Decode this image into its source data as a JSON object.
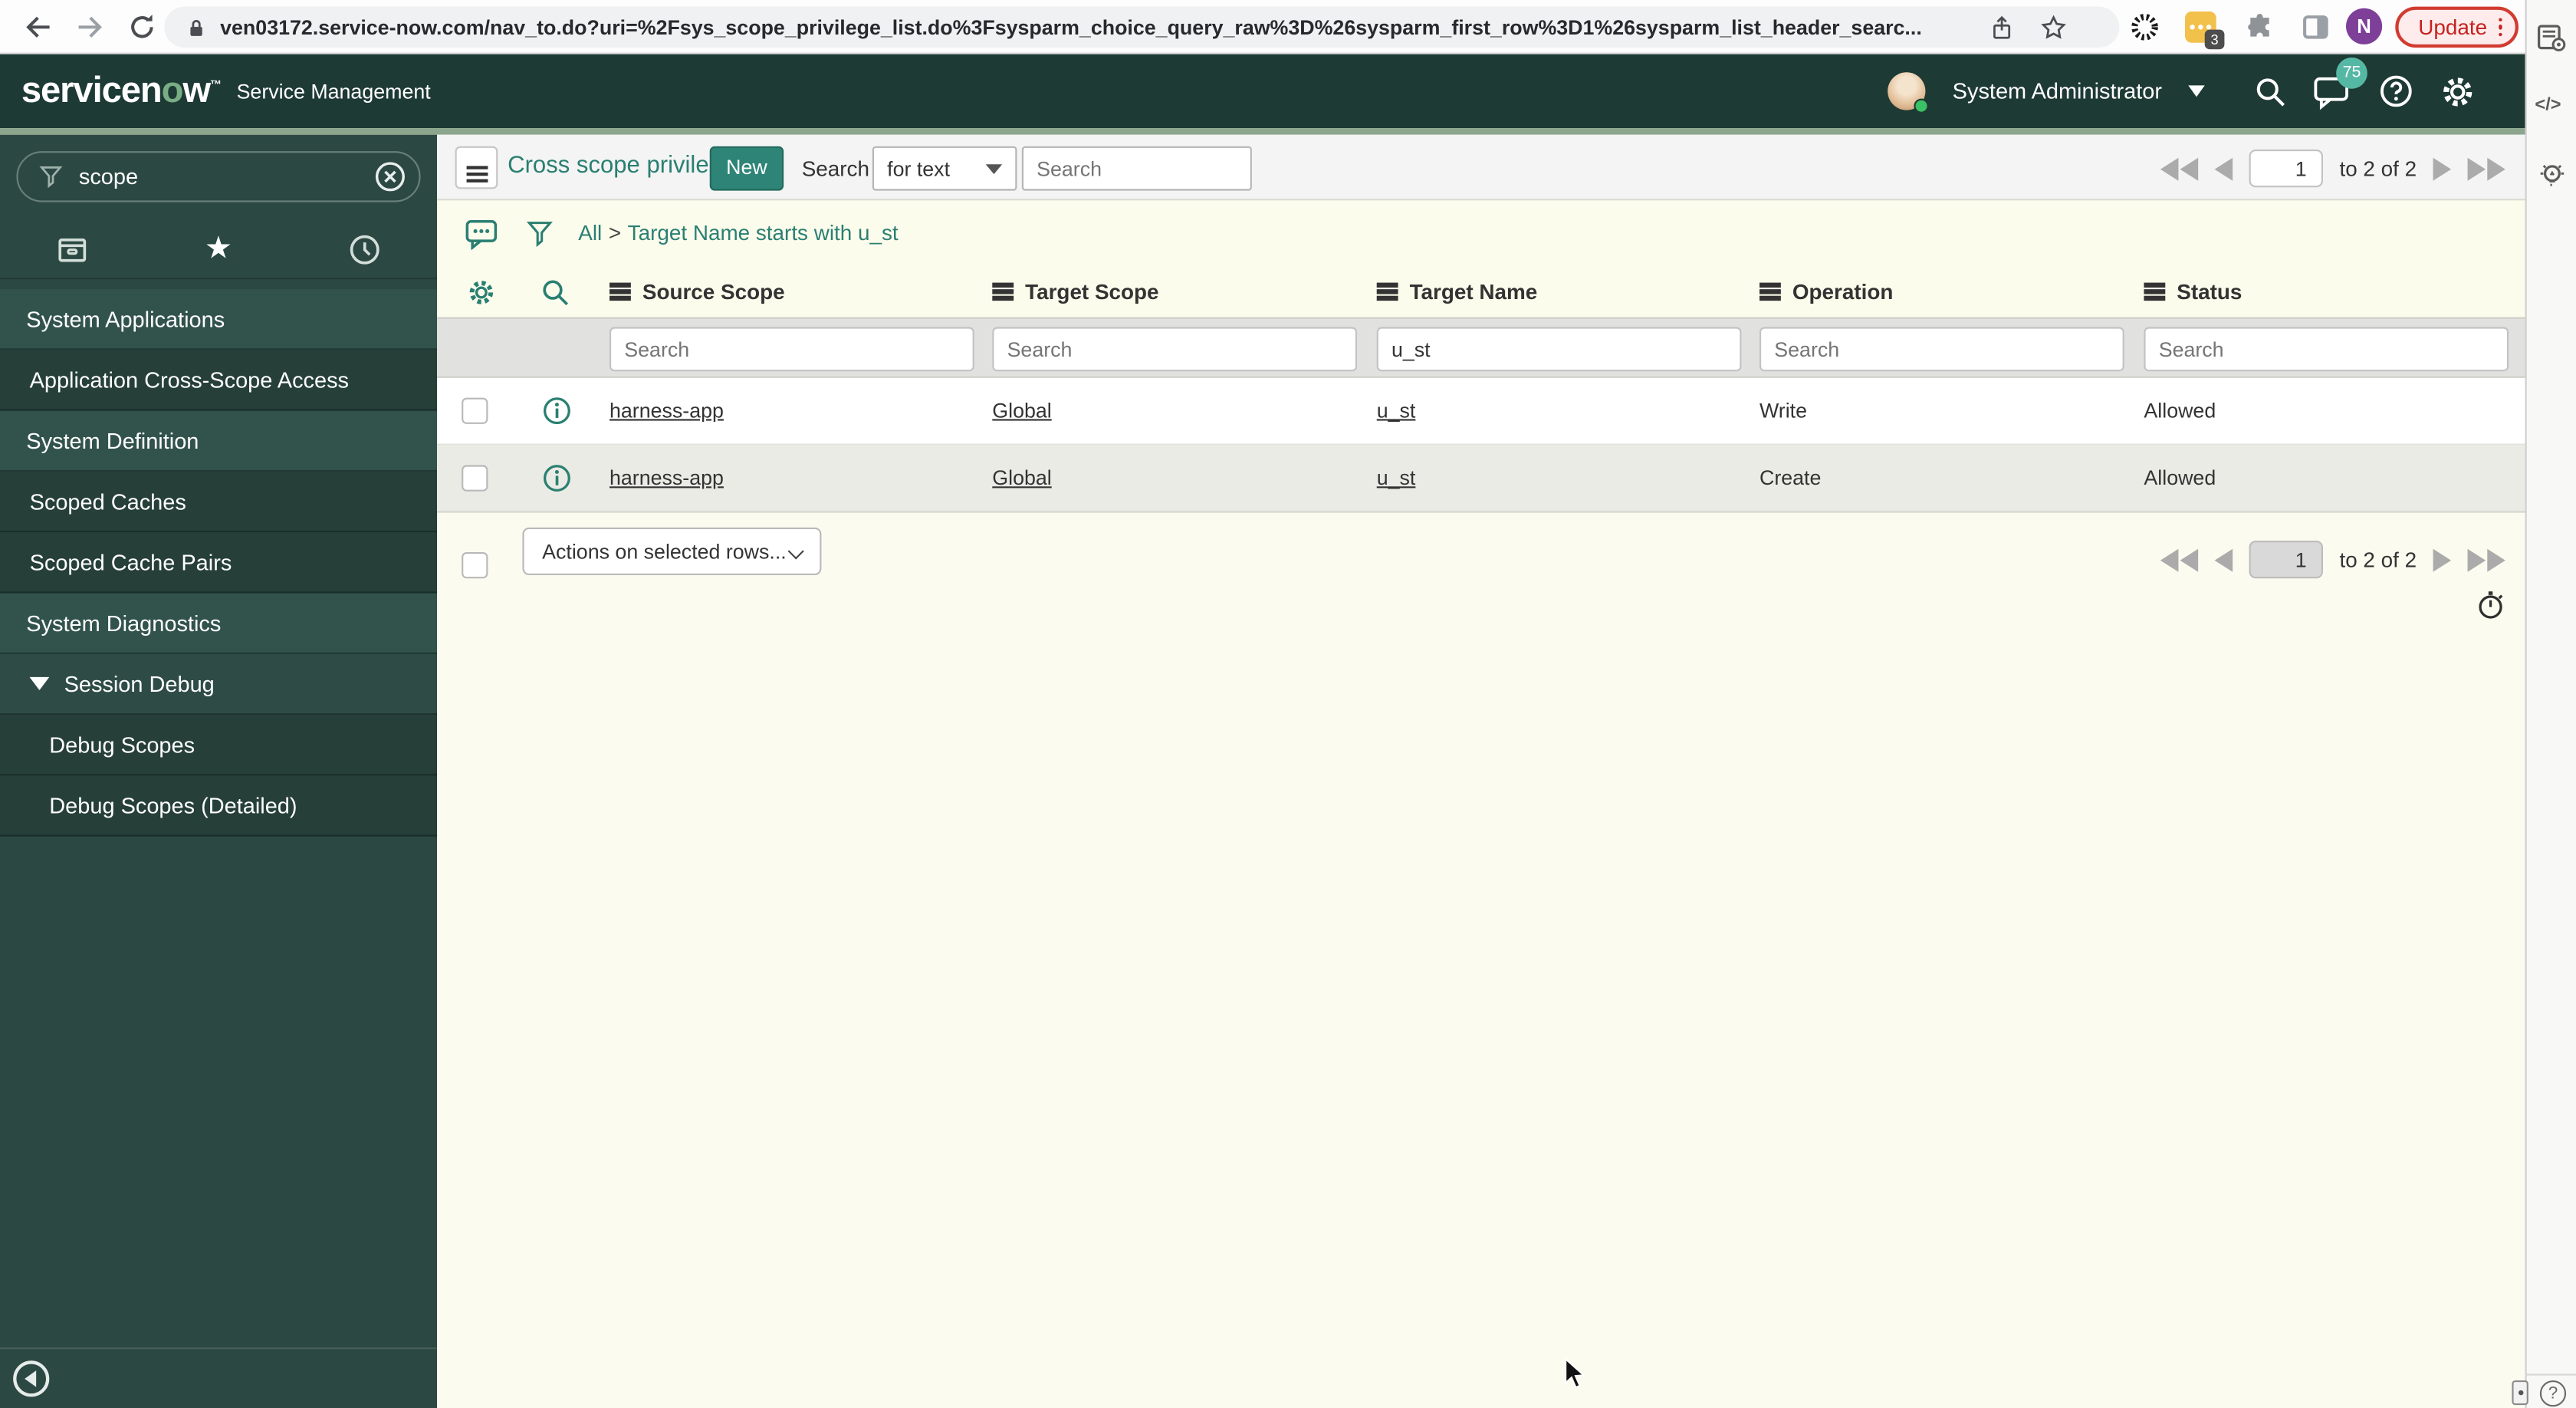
{
  "browser": {
    "url": "ven03172.service-now.com/nav_to.do?uri=%2Fsys_scope_privilege_list.do%3Fsysparm_choice_query_raw%3D%26sysparm_first_row%3D1%26sysparm_list_header_searc...",
    "extension_badge": "3",
    "profile_initial": "N",
    "update_label": "Update"
  },
  "app_header": {
    "logo_pre": "servicen",
    "logo_o": "o",
    "logo_post": "w",
    "product": "Service Management",
    "user_name": "System Administrator",
    "notification_count": "75"
  },
  "sidebar": {
    "filter_value": "scope",
    "items": [
      {
        "label": "System Applications",
        "type": "section"
      },
      {
        "label": "Application Cross-Scope Access",
        "type": "item"
      },
      {
        "label": "System Definition",
        "type": "section"
      },
      {
        "label": "Scoped Caches",
        "type": "item"
      },
      {
        "label": "Scoped Cache Pairs",
        "type": "item"
      },
      {
        "label": "System Diagnostics",
        "type": "section"
      },
      {
        "label": "Session Debug",
        "type": "subsection"
      },
      {
        "label": "Debug Scopes",
        "type": "subitem"
      },
      {
        "label": "Debug Scopes (Detailed)",
        "type": "subitem"
      }
    ]
  },
  "toolbar": {
    "title": "Cross scope privileges",
    "new_button": "New",
    "search_label": "Search",
    "search_type": "for text",
    "search_placeholder": "Search"
  },
  "pagination": {
    "page": "1",
    "range_label": "to 2 of 2"
  },
  "breadcrumb": {
    "root": "All",
    "separator": ">",
    "query": "Target Name starts with u_st"
  },
  "table": {
    "columns": [
      "Source Scope",
      "Target Scope",
      "Target Name",
      "Operation",
      "Status"
    ],
    "filter_placeholder": "Search",
    "target_name_filter": "u_st",
    "rows": [
      {
        "source_scope": "harness-app",
        "target_scope": "Global",
        "target_name": "u_st",
        "operation": "Write",
        "status": "Allowed"
      },
      {
        "source_scope": "harness-app",
        "target_scope": "Global",
        "target_name": "u_st",
        "operation": "Create",
        "status": "Allowed"
      }
    ]
  },
  "footer": {
    "actions_label": "Actions on selected rows..."
  },
  "right_strip": {
    "code_glyph": "</>",
    "help_glyph": "?"
  },
  "colors": {
    "teal": "#2e8577",
    "header_bg": "#1e3a34",
    "sidebar_bg": "#2c4842",
    "accent_line": "#8ba68c",
    "update_red": "#c5221f",
    "badge_teal": "#55b8a4"
  }
}
